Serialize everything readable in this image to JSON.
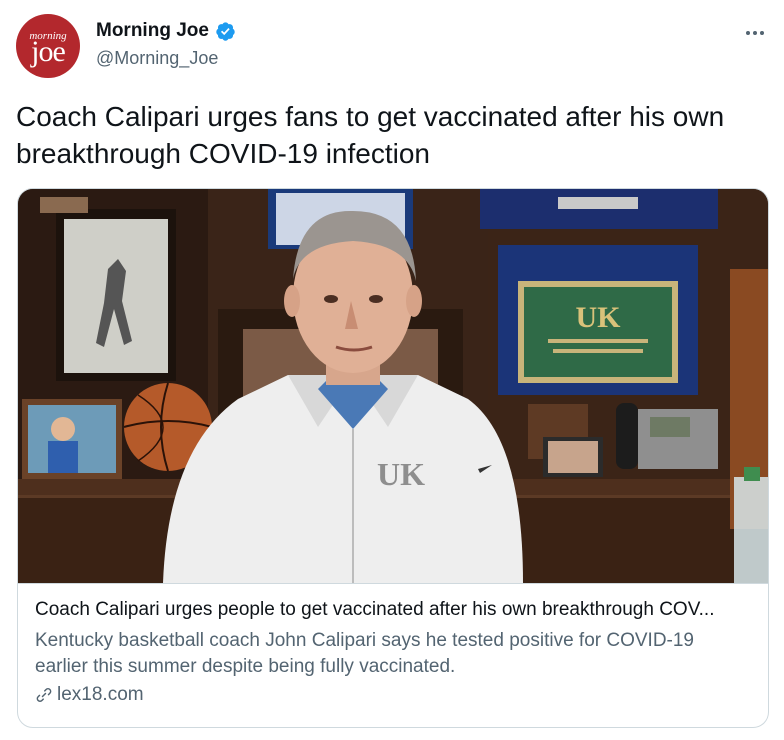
{
  "author": {
    "display_name": "Morning Joe",
    "handle": "@Morning_Joe",
    "avatar_text_small": "morning",
    "avatar_text_big": "joe",
    "verified": true
  },
  "tweet": {
    "text": "Coach Calipari urges fans to get vaccinated after his own breakthrough COVID-19 infection"
  },
  "card": {
    "title": "Coach Calipari urges people to get vaccinated after his own breakthrough COV...",
    "description": "Kentucky basketball coach John Calipari says he tested positive for COVID-19 earlier this summer despite being fully vaccinated.",
    "domain": "lex18.com",
    "plaque_text": "UK",
    "shirt_logo": "UK"
  },
  "colors": {
    "brand_blue": "#1d9bf0",
    "text_primary": "#0f1419",
    "text_secondary": "#536471",
    "border": "#cfd9de",
    "avatar_red": "#b3282d"
  },
  "icons": {
    "more": "more-dots-icon",
    "verified": "verified-badge-icon",
    "link": "link-icon"
  }
}
